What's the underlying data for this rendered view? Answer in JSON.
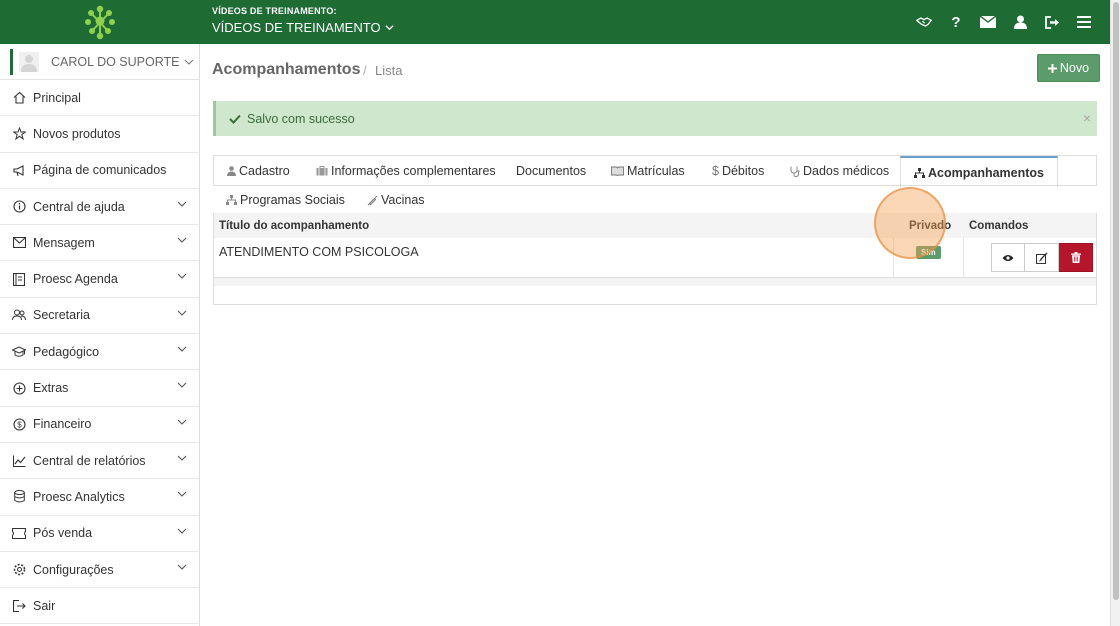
{
  "topbar": {
    "org_label": "VÍDEOS DE TREINAMENTO:",
    "org_name": "VÍDEOS DE TREINAMENTO",
    "icons": [
      "handshake-icon",
      "help-icon",
      "envelope-icon",
      "user-icon",
      "sign-out-icon",
      "menu-icon"
    ],
    "color": "#1e6b34"
  },
  "sidebar": {
    "user_name": "CAROL DO SUPORTE",
    "items": [
      {
        "label": "Principal",
        "icon": "home-icon"
      },
      {
        "label": "Novos produtos",
        "icon": "star-icon"
      },
      {
        "label": "Página de comunicados",
        "icon": "megaphone-icon"
      },
      {
        "label": "Central de ajuda",
        "icon": "info-icon"
      },
      {
        "label": "Mensagem",
        "icon": "mail-icon"
      },
      {
        "label": "Proesc Agenda",
        "icon": "agenda-icon"
      },
      {
        "label": "Secretaria",
        "icon": "users-icon"
      },
      {
        "label": "Pedagógico",
        "icon": "graduation-icon"
      },
      {
        "label": "Extras",
        "icon": "plus-circle-icon"
      },
      {
        "label": "Financeiro",
        "icon": "dollar-icon"
      },
      {
        "label": "Central de relatórios",
        "icon": "chart-line-icon"
      },
      {
        "label": "Proesc Analytics",
        "icon": "database-icon"
      },
      {
        "label": "Pós venda",
        "icon": "ticket-icon"
      },
      {
        "label": "Configurações",
        "icon": "gear-icon"
      },
      {
        "label": "Sair",
        "icon": "exit-icon"
      }
    ]
  },
  "main": {
    "title": "Acompanhamentos",
    "separator": "/",
    "crumb": "Lista",
    "new_button": "Novo",
    "alert": "Salvo com sucesso",
    "alert_close": "×",
    "tabs": [
      "Cadastro",
      "Informações complementares",
      "Documentos",
      "Matrículas",
      "Débitos",
      "Dados médicos",
      "Acompanhamentos"
    ],
    "tabs_row2": [
      "Programas Sociais",
      "Vacinas"
    ],
    "table": {
      "headers": [
        "Título do acompanhamento",
        "Privado",
        "Comandos"
      ],
      "rows": [
        {
          "title": "ATENDIMENTO COM PSICOLOGA",
          "privado": "Sim"
        }
      ]
    }
  }
}
